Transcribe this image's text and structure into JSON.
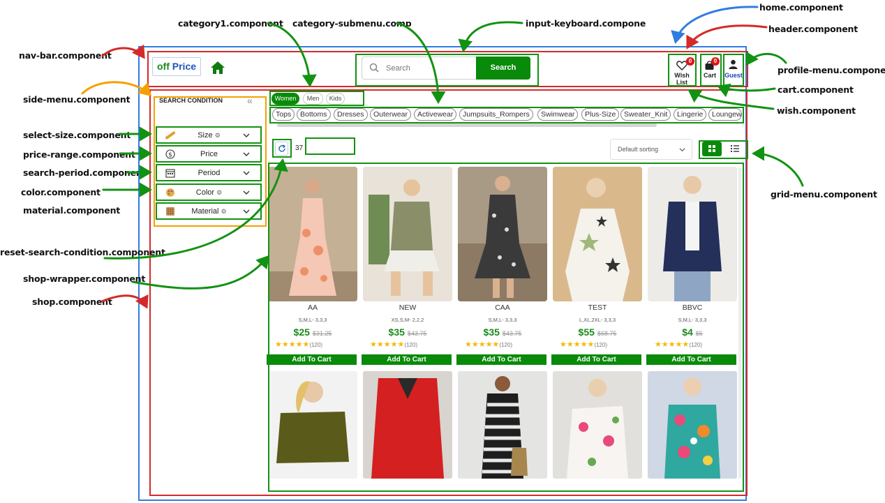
{
  "labels": {
    "home": "home.component",
    "header": "header.component",
    "category1": "category1.component",
    "category_submenu": "category-submenu.comp",
    "input_keyboard": "input-keyboard.compone",
    "nav_bar": "nav-bar.component",
    "profile_menu": "profile-menu.component",
    "side_menu": "side-menu.component",
    "cart": "cart.component",
    "wish": "wish.component",
    "select_size": "select-size.component",
    "price_range": "price-range.component",
    "search_period": "search-period.componen",
    "color": "color.component",
    "material": "material.component",
    "grid_menu": "grid-menu.component",
    "reset_search": "reset-search-condition.component",
    "shop_wrapper": "shop-wrapper.component",
    "shop": "shop.component"
  },
  "annotation_colors": {
    "red": "#d42a2a",
    "green": "#129212",
    "blue": "#2f7de0",
    "orange": "#f5a000"
  },
  "app": {
    "logo": {
      "part1": "off",
      "part2": "Price"
    },
    "search": {
      "placeholder": "Search",
      "button": "Search"
    },
    "header": {
      "wish_label": "Wish List",
      "wish_count": "0",
      "cart_label": "Cart",
      "cart_count": "0",
      "profile_label": "Guest"
    },
    "side_menu": {
      "title": "SEARCH CONDITION",
      "filters": [
        {
          "label": "Size",
          "icon": "ruler-icon",
          "has_gear": true
        },
        {
          "label": "Price",
          "icon": "dollar-icon",
          "has_gear": false
        },
        {
          "label": "Period",
          "icon": "calendar-icon",
          "has_gear": false
        },
        {
          "label": "Color",
          "icon": "palette-icon",
          "has_gear": true
        },
        {
          "label": "Material",
          "icon": "fabric-icon",
          "has_gear": true
        }
      ]
    },
    "categories": [
      {
        "label": "Women",
        "active": true
      },
      {
        "label": "Men",
        "active": false
      },
      {
        "label": "Kids",
        "active": false
      }
    ],
    "subcategories": [
      "Tops",
      "Bottoms",
      "Dresses",
      "Outerwear",
      "Activewear",
      "Jumpsuits_Rompers",
      "Swimwear",
      "Plus-Size",
      "Sweater_Knit",
      "Lingerie",
      "Loungew"
    ],
    "result_count": "37",
    "sort_label": "Default sorting",
    "products": [
      {
        "name": "AA",
        "sizes": "S,M,L- 3,3,3",
        "price": "$25",
        "old_price": "$31.25",
        "stars": "★★★★★",
        "reviews": "(120)",
        "cta": "Add To Cart"
      },
      {
        "name": "NEW",
        "sizes": "XS,S,M- 2,2,2",
        "price": "$35",
        "old_price": "$43.75",
        "stars": "★★★★★",
        "reviews": "(120)",
        "cta": "Add To Cart"
      },
      {
        "name": "CAA",
        "sizes": "S,M,L- 3,3,3",
        "price": "$35",
        "old_price": "$43.75",
        "stars": "★★★★★",
        "reviews": "(120)",
        "cta": "Add To Cart"
      },
      {
        "name": "TEST",
        "sizes": "L,XL,2XL- 3,3,3",
        "price": "$55",
        "old_price": "$68.75",
        "stars": "★★★★★",
        "reviews": "(120)",
        "cta": "Add To Cart"
      },
      {
        "name": "BBVC",
        "sizes": "S,M,L- 3,3,3",
        "price": "$4",
        "old_price": "$5",
        "stars": "★★★★★",
        "reviews": "(120)",
        "cta": "Add To Cart"
      }
    ]
  }
}
